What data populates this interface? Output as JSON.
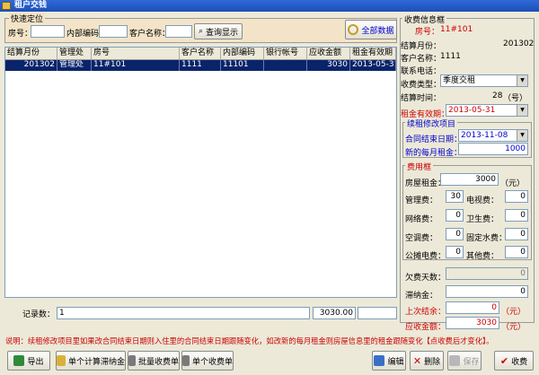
{
  "window": {
    "title": "租户交钱"
  },
  "quick": {
    "group_title": "快速定位",
    "room_label": "房号：",
    "code_label": "内部编码：",
    "customer_label": "客户名称：",
    "search_label": "查询显示",
    "all_label": "全部数据"
  },
  "grid": {
    "columns": [
      "结算月份",
      "管理处",
      "房号",
      "客户名称",
      "内部编码",
      "银行帐号",
      "应收金额",
      "租金有效期"
    ],
    "rows": [
      {
        "month": "201302",
        "office": "管理处",
        "room": "11#101",
        "customer": "1111",
        "code": "11101",
        "bank": "",
        "amount": "3030",
        "expiry": "2013-05-31"
      }
    ]
  },
  "footer": {
    "count_label": "记录数：",
    "count_value": "1",
    "total_value": "3030.00"
  },
  "info": {
    "group_title": "收费信息框",
    "room_label": "房号：",
    "room_value": "11#101",
    "month_label": "结算月份：",
    "month_value": "201302",
    "customer_label": "客户名称：",
    "customer_value": "1111",
    "phone_label": "联系电话：",
    "type_label": "收费类型：",
    "type_value": "季度交租",
    "time_label": "结算时间：",
    "time_value": "28",
    "time_unit": "（号）",
    "expiry_label": "租金有效期：",
    "expiry_value": "2013-05-31"
  },
  "modify": {
    "group_title": "续租修改项目",
    "contract_end_label": "合同结束日期：",
    "contract_end_value": "2013-11-08",
    "new_rent_label": "新的每月租金：",
    "new_rent_value": "1000"
  },
  "fees": {
    "group_title": "费用框",
    "rent_label": "房屋租金：",
    "rent_value": "3000",
    "rent_unit": "（元）",
    "mgmt_label": "管理费：",
    "mgmt_value": "30",
    "tv_label": "电视费：",
    "tv_value": "0",
    "net_label": "网络费：",
    "net_value": "0",
    "sanitary_label": "卫生费：",
    "sanitary_value": "0",
    "ac_label": "空调费：",
    "ac_value": "0",
    "water_label": "固定水费：",
    "water_value": "0",
    "power_label": "公摊电费：",
    "power_value": "0",
    "other_label": "其他费：",
    "other_value": "0",
    "arrears_days_label": "欠费天数：",
    "arrears_days_value": "0",
    "late_fee_label": "滞纳金：",
    "late_fee_value": "0",
    "last_balance_label": "上次结余：",
    "last_balance_value": "0",
    "last_balance_unit": "（元）",
    "receivable_label": "应收金额：",
    "receivable_value": "3030",
    "receivable_unit": "（元）"
  },
  "note": "说明：续租修改项目里如果改合同结束日期则入住里的合同结束日期跟随变化，如改新的每月租金则房屋信息里的租金跟随变化【点收费后才变化】。",
  "toolbar": {
    "export": "导出",
    "single_late": "单个计算滞纳金",
    "batch_bill": "批量收费单",
    "single_bill": "单个收费单",
    "edit": "编辑",
    "delete": "删除",
    "save": "保存",
    "charge": "收费"
  },
  "colors": {
    "title_bar": "#1c4fb8",
    "selected_row": "#0a246a",
    "red_label": "#cc0000",
    "blue_value": "#0000cc"
  }
}
